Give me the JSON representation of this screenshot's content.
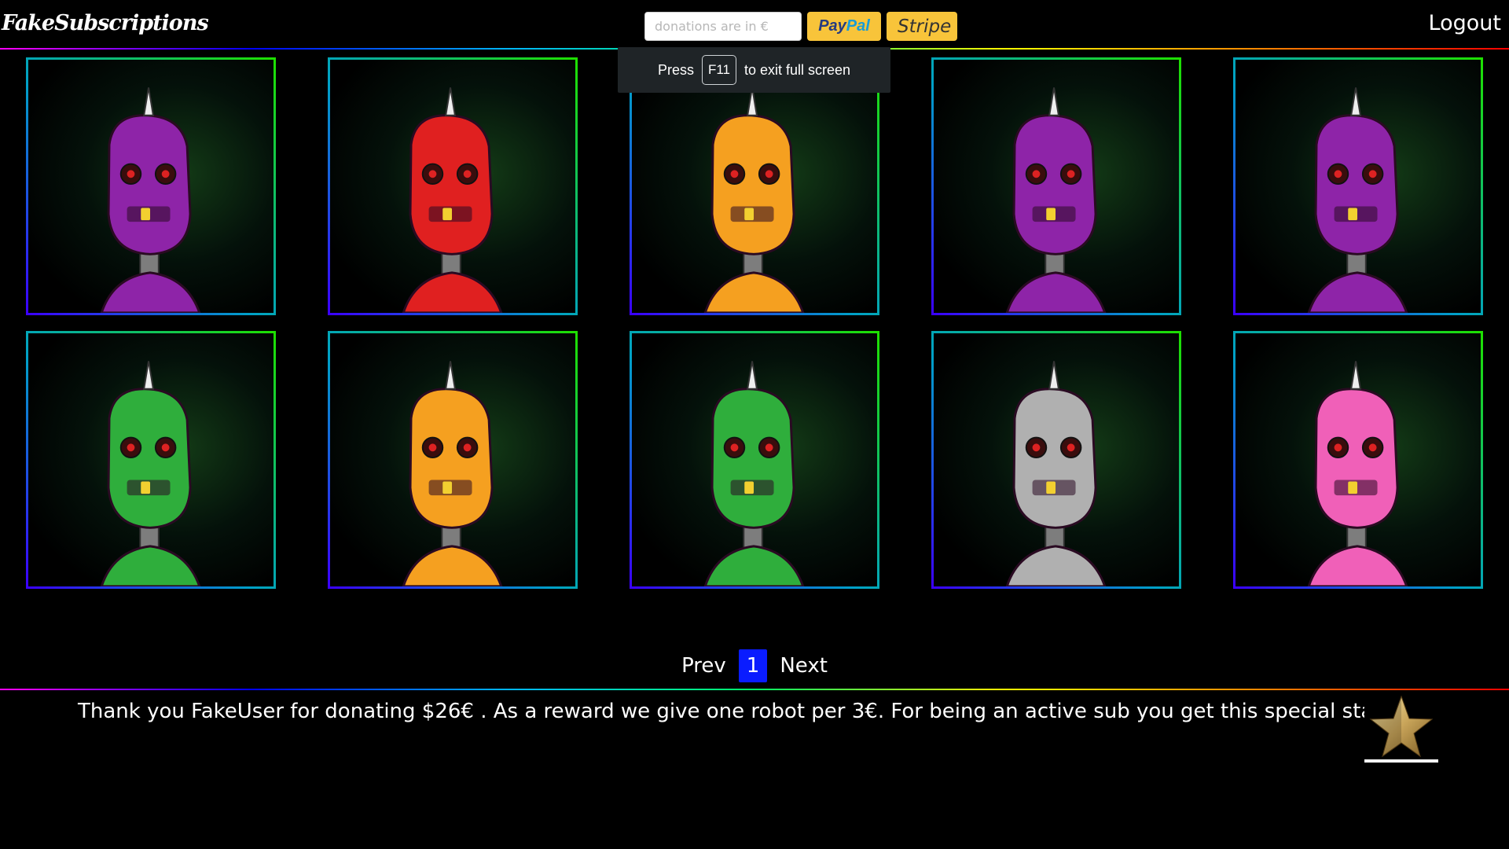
{
  "header": {
    "brand": "FakeSubscriptions",
    "donation_placeholder": "donations are in €",
    "paypal_part1": "Pay",
    "paypal_part2": "Pal",
    "stripe_label": "Stripe",
    "logout_label": "Logout"
  },
  "fullscreen_toast": {
    "before": "Press",
    "key": "F11",
    "after": "to exit full screen"
  },
  "robots": [
    {
      "color": "#8e24a8",
      "accent": "purple"
    },
    {
      "color": "#e02020",
      "accent": "red"
    },
    {
      "color": "#f5a020",
      "accent": "orange"
    },
    {
      "color": "#8e24a8",
      "accent": "purple"
    },
    {
      "color": "#8e24a8",
      "accent": "purple"
    },
    {
      "color": "#2fae3c",
      "accent": "green"
    },
    {
      "color": "#f5a020",
      "accent": "orange"
    },
    {
      "color": "#2fae3c",
      "accent": "green"
    },
    {
      "color": "#b0b0b0",
      "accent": "silver"
    },
    {
      "color": "#f060b8",
      "accent": "pink"
    }
  ],
  "pagination": {
    "prev_label": "Prev",
    "current_page": "1",
    "next_label": "Next"
  },
  "footer": {
    "message": "Thank you FakeUser for donating $26€ . As a reward we give one robot per 3€.  For being an active sub you get this special star",
    "badge_icon": "gold-star-icon"
  }
}
